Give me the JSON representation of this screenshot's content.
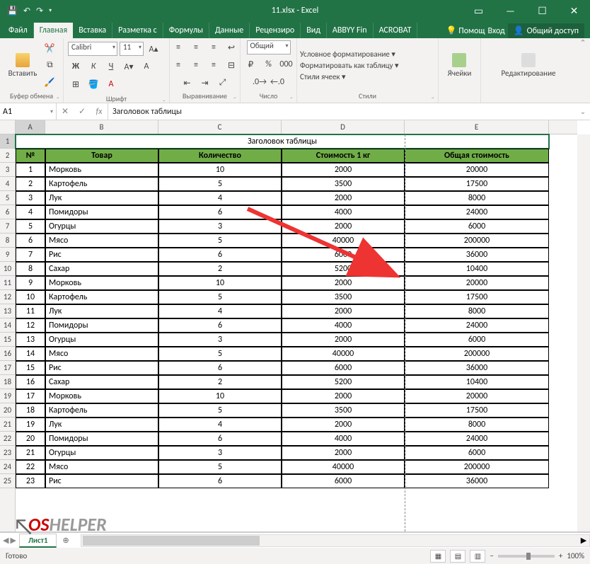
{
  "title": "11.xlsx - Excel",
  "tabs": [
    "Файл",
    "Главная",
    "Вставка",
    "Разметка с",
    "Формулы",
    "Данные",
    "Рецензиро",
    "Вид",
    "ABBYY Fin",
    "ACROBAT"
  ],
  "help": "Помощ",
  "login": "Вход",
  "share": "Общий доступ",
  "ribbon": {
    "paste": "Вставить",
    "clipboard_label": "Буфер обмена",
    "font_name": "Calibri",
    "font_size": "11",
    "font_label": "Шрифт",
    "align_label": "Выравнивание",
    "number_format": "Общий",
    "number_label": "Число",
    "cond_fmt": "Условное форматирование ▾",
    "as_table": "Форматировать как таблицу ▾",
    "cell_styles": "Стили ячеек ▾",
    "styles_label": "Стили",
    "cells": "Ячейки",
    "editing": "Редактирование"
  },
  "namebox": "A1",
  "formula": "Заголовок таблицы",
  "columns": [
    "A",
    "B",
    "C",
    "D",
    "E"
  ],
  "table_title": "Заголовок таблицы",
  "headers": [
    "№",
    "Товар",
    "Количество",
    "Стоимость 1 кг",
    "Общая стоимость"
  ],
  "rows": [
    {
      "n": "1",
      "item": "Морковь",
      "qty": "10",
      "price": "2000",
      "total": "20000"
    },
    {
      "n": "2",
      "item": "Картофель",
      "qty": "5",
      "price": "3500",
      "total": "17500"
    },
    {
      "n": "3",
      "item": "Лук",
      "qty": "4",
      "price": "2000",
      "total": "8000"
    },
    {
      "n": "4",
      "item": "Помидоры",
      "qty": "6",
      "price": "4000",
      "total": "24000"
    },
    {
      "n": "5",
      "item": "Огурцы",
      "qty": "3",
      "price": "2000",
      "total": "6000"
    },
    {
      "n": "6",
      "item": "Мясо",
      "qty": "5",
      "price": "40000",
      "total": "200000"
    },
    {
      "n": "7",
      "item": "Рис",
      "qty": "6",
      "price": "6000",
      "total": "36000"
    },
    {
      "n": "8",
      "item": "Сахар",
      "qty": "2",
      "price": "5200",
      "total": "10400"
    },
    {
      "n": "9",
      "item": "Морковь",
      "qty": "10",
      "price": "2000",
      "total": "20000"
    },
    {
      "n": "10",
      "item": "Картофель",
      "qty": "5",
      "price": "3500",
      "total": "17500"
    },
    {
      "n": "11",
      "item": "Лук",
      "qty": "4",
      "price": "2000",
      "total": "8000"
    },
    {
      "n": "12",
      "item": "Помидоры",
      "qty": "6",
      "price": "4000",
      "total": "24000"
    },
    {
      "n": "13",
      "item": "Огурцы",
      "qty": "3",
      "price": "2000",
      "total": "6000"
    },
    {
      "n": "14",
      "item": "Мясо",
      "qty": "5",
      "price": "40000",
      "total": "200000"
    },
    {
      "n": "15",
      "item": "Рис",
      "qty": "6",
      "price": "6000",
      "total": "36000"
    },
    {
      "n": "16",
      "item": "Сахар",
      "qty": "2",
      "price": "5200",
      "total": "10400"
    },
    {
      "n": "17",
      "item": "Морковь",
      "qty": "10",
      "price": "2000",
      "total": "20000"
    },
    {
      "n": "18",
      "item": "Картофель",
      "qty": "5",
      "price": "3500",
      "total": "17500"
    },
    {
      "n": "19",
      "item": "Лук",
      "qty": "4",
      "price": "2000",
      "total": "8000"
    },
    {
      "n": "20",
      "item": "Помидоры",
      "qty": "6",
      "price": "4000",
      "total": "24000"
    },
    {
      "n": "21",
      "item": "Огурцы",
      "qty": "3",
      "price": "2000",
      "total": "6000"
    },
    {
      "n": "22",
      "item": "Мясо",
      "qty": "5",
      "price": "40000",
      "total": "200000"
    },
    {
      "n": "23",
      "item": "Рис",
      "qty": "6",
      "price": "6000",
      "total": "36000"
    }
  ],
  "sheet": "Лист1",
  "status": "Готово",
  "zoom": "100%",
  "watermark": {
    "os": "OS",
    "helper": "HELPER"
  }
}
